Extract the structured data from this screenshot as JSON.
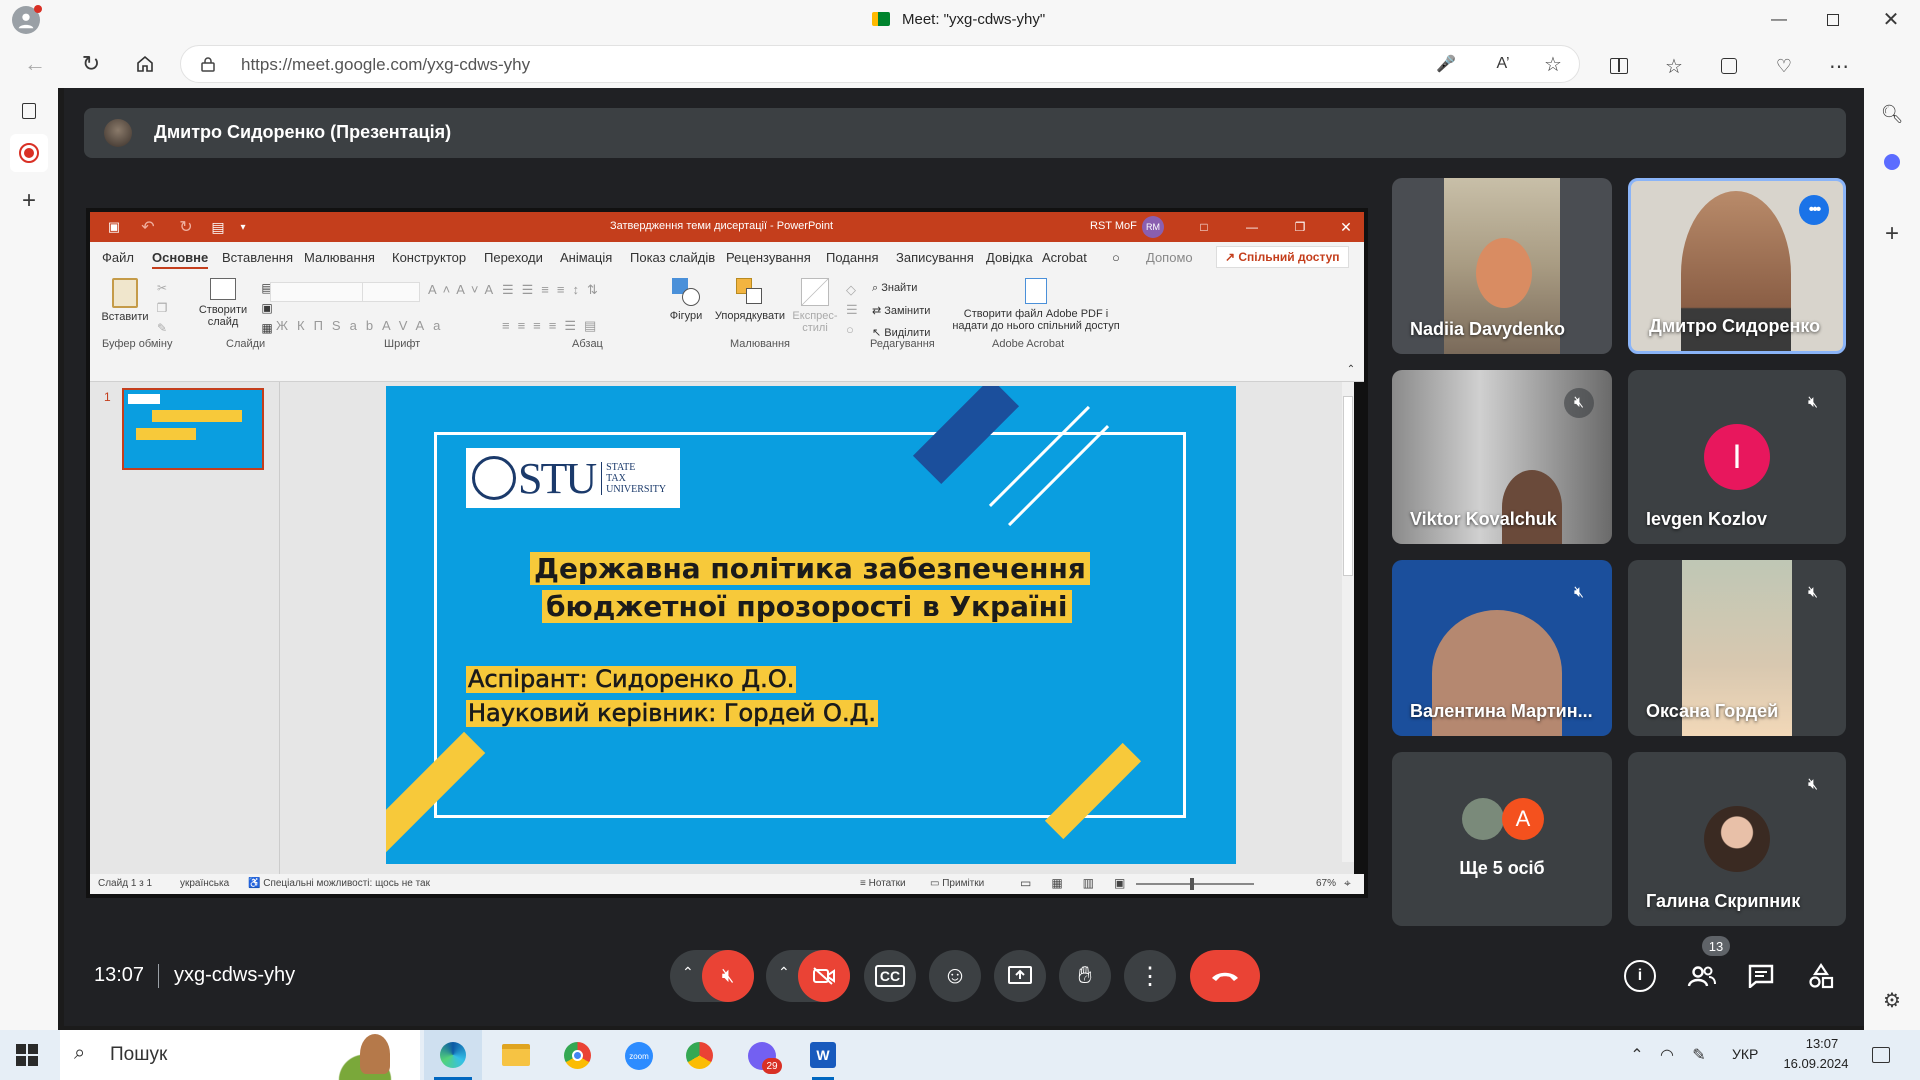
{
  "browser": {
    "tab_title": "Meet: \"yxg-cdws-yhy\"",
    "url": "https://meet.google.com/yxg-cdws-yhy"
  },
  "presenter_bar": {
    "title": "Дмитро Сидоренко (Презентація)"
  },
  "ppt": {
    "window_title": "Затвердження теми дисертації - PowerPoint",
    "org": "RST MoF",
    "user_initials": "RM",
    "tabs": [
      "Файл",
      "Основне",
      "Вставлення",
      "Малювання",
      "Конструктор",
      "Переходи",
      "Анімація",
      "Показ слайдів",
      "Рецензування",
      "Подання",
      "Записування",
      "Довідка",
      "Acrobat"
    ],
    "help_search": "Допомо",
    "share_label": "Спільний доступ",
    "groups": {
      "clipboard": "Буфер обміну",
      "slides": "Слайди",
      "font": "Шрифт",
      "paragraph": "Абзац",
      "drawing": "Малювання",
      "editing": "Редагування",
      "acrobat": "Adobe Acrobat"
    },
    "buttons": {
      "paste": "Вставити",
      "new_slide_1": "Створити",
      "new_slide_2": "слайд",
      "shapes": "Фігури",
      "arrange": "Упорядкувати",
      "quick_styles_1": "Експрес-",
      "quick_styles_2": "стилі",
      "find": "Знайти",
      "replace": "Замінити",
      "select": "Виділити",
      "acrobat_1": "Створити файл Adobe PDF і",
      "acrobat_2": "надати до нього спільний доступ"
    },
    "thumb_number": "1",
    "slide": {
      "logo_text": "STU",
      "logo_sub_1": "STATE",
      "logo_sub_2": "TAX",
      "logo_sub_3": "UNIVERSITY",
      "title_line1": "Державна політика забезпечення",
      "title_line2": "бюджетної прозорості в Україні",
      "author_line1": "Аспірант: Сидоренко Д.О.",
      "author_line2": "Науковий керівник: Гордей О.Д."
    },
    "status": {
      "slide_of": "Слайд 1 з 1",
      "language": "українська",
      "accessibility": "Спеціальні можливості: щось не так",
      "notes": "Нотатки",
      "comments": "Примітки",
      "zoom": "67%"
    }
  },
  "participants": [
    {
      "name": "Nadiia Davydenko",
      "muted": false
    },
    {
      "name": "Дмитро Сидоренко",
      "muted": false,
      "speaking": true
    },
    {
      "name": "Viktor Kovalchuk",
      "muted": true
    },
    {
      "name": "Ievgen Kozlov",
      "muted": true,
      "avatar_letter": "I",
      "avatar_color": "#e8175d"
    },
    {
      "name": "Валентина Мартин...",
      "muted": true
    },
    {
      "name": "Оксана Гордей",
      "muted": true
    },
    {
      "name": "Ще 5 осіб",
      "muted": false,
      "avatar_letter": "A",
      "avatar_color": "#f4511e"
    },
    {
      "name": "Галина Скрипник",
      "muted": true
    }
  ],
  "meeting": {
    "time": "13:07",
    "code": "yxg-cdws-yhy",
    "people_count": "13"
  },
  "taskbar": {
    "search": "Пошук",
    "lang": "УКР",
    "time": "13:07",
    "date": "16.09.2024",
    "viber_badge": "29",
    "zoom_label": "zoom"
  },
  "colors": {
    "meet_bg": "#202124",
    "tile_bg": "#3c4043",
    "end_call": "#ea4335",
    "ppt_ribbon": "#c43e1c",
    "slide_bg": "#0a9ee0",
    "highlight": "#f7c93a"
  }
}
